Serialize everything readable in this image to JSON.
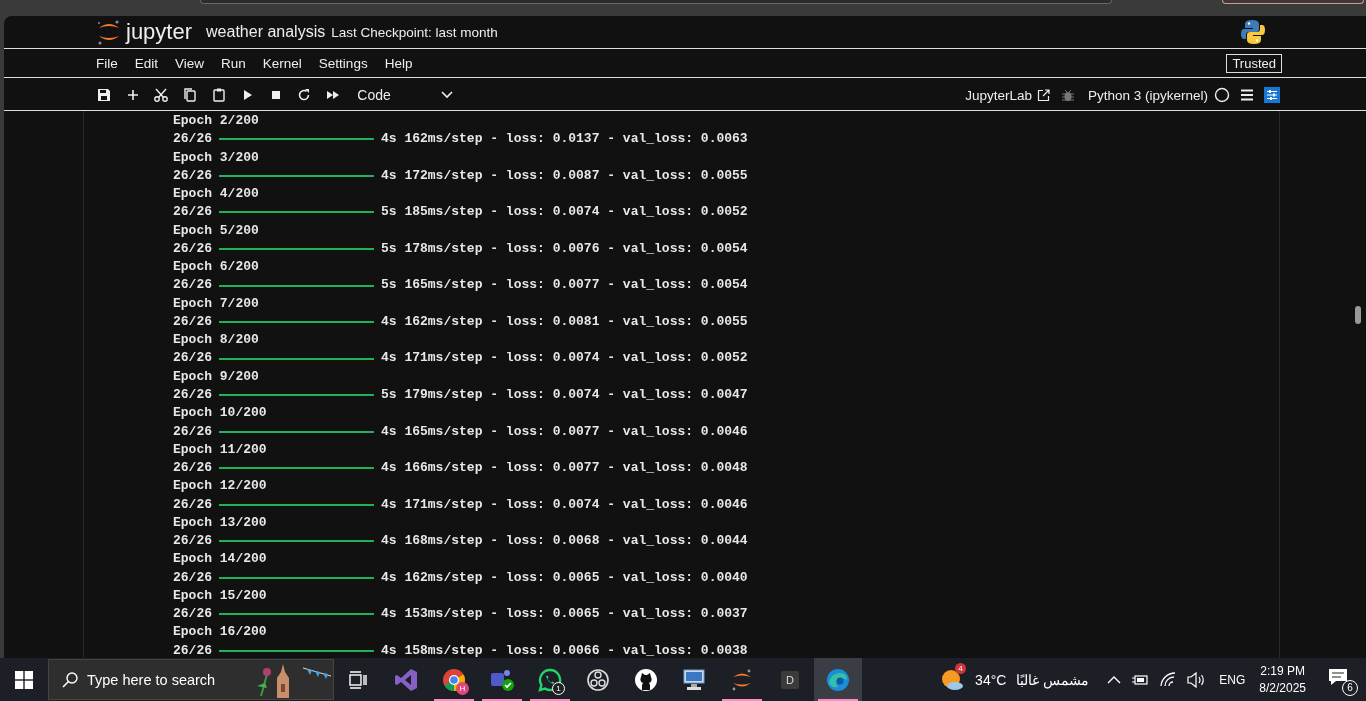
{
  "header": {
    "logo_text": "jupyter",
    "notebook_name": "weather analysis",
    "checkpoint": "Last Checkpoint: last month",
    "trusted": "Trusted"
  },
  "menu": [
    "File",
    "Edit",
    "View",
    "Run",
    "Kernel",
    "Settings",
    "Help"
  ],
  "toolbar": {
    "buttons": [
      {
        "kind": "save"
      },
      {
        "kind": "add"
      },
      {
        "kind": "cut"
      },
      {
        "kind": "copy"
      },
      {
        "kind": "paste"
      },
      {
        "kind": "run"
      },
      {
        "kind": "stop"
      },
      {
        "kind": "restart"
      },
      {
        "kind": "run-all"
      }
    ],
    "cell_type": "Code",
    "jupyterlab_link": "JupyterLab",
    "kernel_name": "Python 3 (ipykernel)",
    "kernel_busy": false
  },
  "output": [
    {
      "epoch": "Epoch 2/200",
      "steps": "26/26",
      "level": 1,
      "stats": "4s 162ms/step - loss: 0.0137 - val_loss: 0.0063"
    },
    {
      "epoch": "Epoch 3/200",
      "steps": "26/26",
      "level": 1,
      "stats": "4s 172ms/step - loss: 0.0087 - val_loss: 0.0055"
    },
    {
      "epoch": "Epoch 4/200",
      "steps": "26/26",
      "level": 1,
      "stats": "5s 185ms/step - loss: 0.0074 - val_loss: 0.0052"
    },
    {
      "epoch": "Epoch 5/200",
      "steps": "26/26",
      "level": 1,
      "stats": "5s 178ms/step - loss: 0.0076 - val_loss: 0.0054"
    },
    {
      "epoch": "Epoch 6/200",
      "steps": "26/26",
      "level": 1,
      "stats": "5s 165ms/step - loss: 0.0077 - val_loss: 0.0054"
    },
    {
      "epoch": "Epoch 7/200",
      "steps": "26/26",
      "level": 1,
      "stats": "4s 162ms/step - loss: 0.0081 - val_loss: 0.0055"
    },
    {
      "epoch": "Epoch 8/200",
      "steps": "26/26",
      "level": 1,
      "stats": "4s 171ms/step - loss: 0.0074 - val_loss: 0.0052"
    },
    {
      "epoch": "Epoch 9/200",
      "steps": "26/26",
      "level": 1,
      "stats": "5s 179ms/step - loss: 0.0074 - val_loss: 0.0047"
    },
    {
      "epoch": "Epoch 10/200",
      "steps": "26/26",
      "level": 1,
      "stats": "4s 165ms/step - loss: 0.0077 - val_loss: 0.0046"
    },
    {
      "epoch": "Epoch 11/200",
      "steps": "26/26",
      "level": 1,
      "stats": "4s 166ms/step - loss: 0.0077 - val_loss: 0.0048"
    },
    {
      "epoch": "Epoch 12/200",
      "steps": "26/26",
      "level": 1,
      "stats": "4s 171ms/step - loss: 0.0074 - val_loss: 0.0046"
    },
    {
      "epoch": "Epoch 13/200",
      "steps": "26/26",
      "level": 1,
      "stats": "4s 168ms/step - loss: 0.0068 - val_loss: 0.0044"
    },
    {
      "epoch": "Epoch 14/200",
      "steps": "26/26",
      "level": 1,
      "stats": "4s 162ms/step - loss: 0.0065 - val_loss: 0.0040"
    },
    {
      "epoch": "Epoch 15/200",
      "steps": "26/26",
      "level": 1,
      "stats": "4s 153ms/step - loss: 0.0065 - val_loss: 0.0037"
    },
    {
      "epoch": "Epoch 16/200",
      "steps": "26/26",
      "level": 1,
      "stats": "4s 158ms/step - loss: 0.0066 - val_loss: 0.0038"
    }
  ],
  "taskbar": {
    "search_placeholder": "Type here to search",
    "apps": [
      {
        "kind": "taskview",
        "running": false,
        "selected": false
      },
      {
        "kind": "visualstudio",
        "running": false,
        "selected": false
      },
      {
        "kind": "chrome",
        "running": true,
        "selected": false,
        "badge": "H"
      },
      {
        "kind": "teams",
        "running": true,
        "selected": false
      },
      {
        "kind": "whatsapp",
        "running": true,
        "selected": false,
        "badge": "1"
      },
      {
        "kind": "obs",
        "running": false,
        "selected": false
      },
      {
        "kind": "github",
        "running": false,
        "selected": false
      },
      {
        "kind": "network",
        "running": false,
        "selected": false
      },
      {
        "kind": "jupyter",
        "running": true,
        "selected": false
      },
      {
        "kind": "letter",
        "running": false,
        "selected": false,
        "label": "D"
      },
      {
        "kind": "edge",
        "running": true,
        "selected": true
      }
    ],
    "weather": {
      "badge": "4",
      "temperature": "34°C",
      "condition": "مشمس غالبًا"
    },
    "language": "ENG",
    "time": "2:19 PM",
    "date": "8/2/2025",
    "notifications": "6"
  }
}
